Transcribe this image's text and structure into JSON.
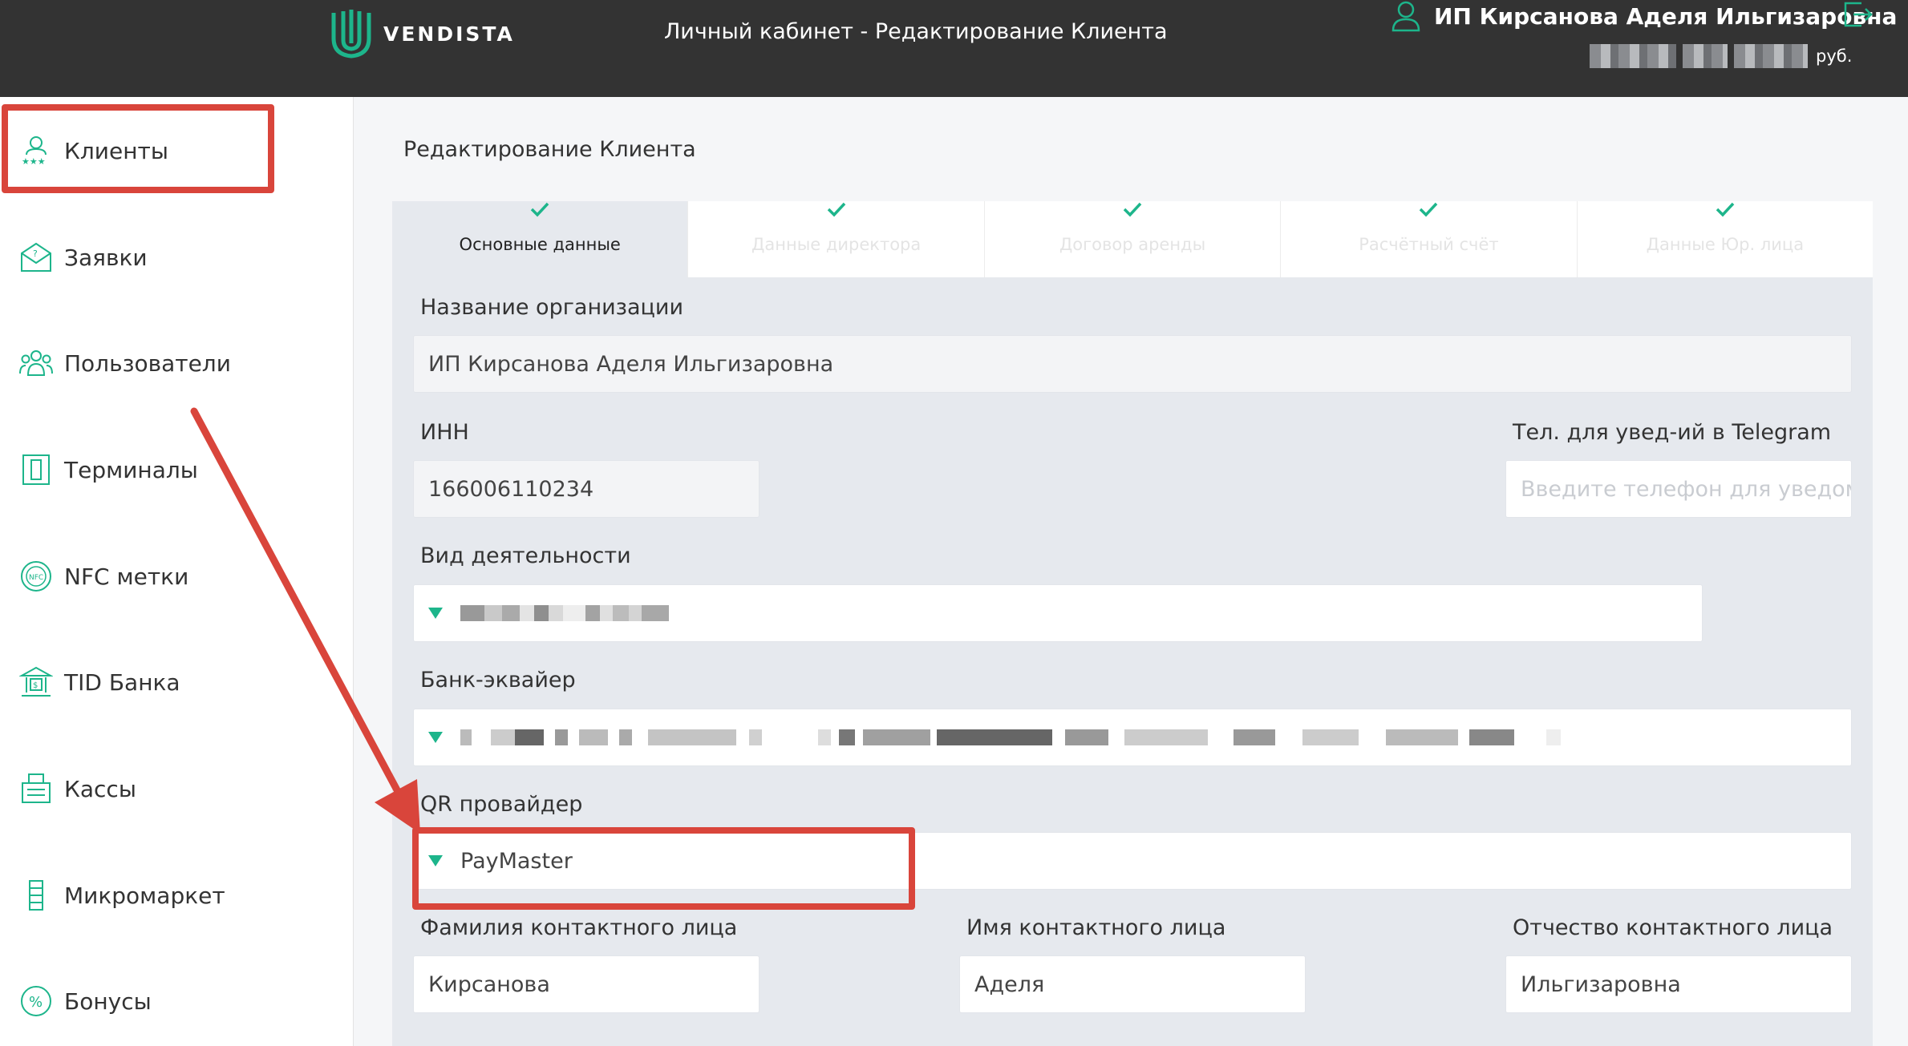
{
  "header": {
    "brand": "VENDISTA",
    "title": "Личный кабинет - Редактирование Клиента",
    "user_name": "ИП Кирсанова Аделя Ильгизаровна",
    "currency": "руб."
  },
  "sidebar": {
    "items": [
      {
        "label": "Клиенты",
        "icon": "clients-icon"
      },
      {
        "label": "Заявки",
        "icon": "requests-icon"
      },
      {
        "label": "Пользователи",
        "icon": "users-icon"
      },
      {
        "label": "Терминалы",
        "icon": "terminal-icon"
      },
      {
        "label": "NFC метки",
        "icon": "nfc-icon"
      },
      {
        "label": "TID Банка",
        "icon": "bank-icon"
      },
      {
        "label": "Кассы",
        "icon": "cash-register-icon"
      },
      {
        "label": "Микромаркет",
        "icon": "micromarket-icon"
      },
      {
        "label": "Бонусы",
        "icon": "bonus-icon"
      }
    ]
  },
  "main": {
    "heading": "Редактирование Клиента",
    "steps": [
      {
        "label": "Основные данные",
        "active": true
      },
      {
        "label": "Данные директора",
        "active": false
      },
      {
        "label": "Договор аренды",
        "active": false
      },
      {
        "label": "Расчётный счёт",
        "active": false
      },
      {
        "label": "Данные Юр. лица",
        "active": false
      }
    ],
    "form": {
      "org_name_label": "Название организации",
      "org_name_value": "ИП Кирсанова Аделя Ильгизаровна",
      "inn_label": "ИНН",
      "inn_value": "166006110234",
      "telegram_label": "Тел. для увед-ий в Telegram",
      "telegram_placeholder": "Введите телефон для уведом",
      "activity_label": "Вид деятельности",
      "bank_label": "Банк-эквайер",
      "qr_label": "QR провайдер",
      "qr_value": "PayMaster",
      "last_name_label": "Фамилия контактного лица",
      "last_name_value": "Кирсанова",
      "first_name_label": "Имя контактного лица",
      "first_name_value": "Аделя",
      "middle_name_label": "Отчество контактного лица",
      "middle_name_value": "Ильгизаровна"
    }
  },
  "colors": {
    "header_bg": "#333333",
    "accent_green": "#1db58b",
    "annotation_red": "#d9453b"
  }
}
